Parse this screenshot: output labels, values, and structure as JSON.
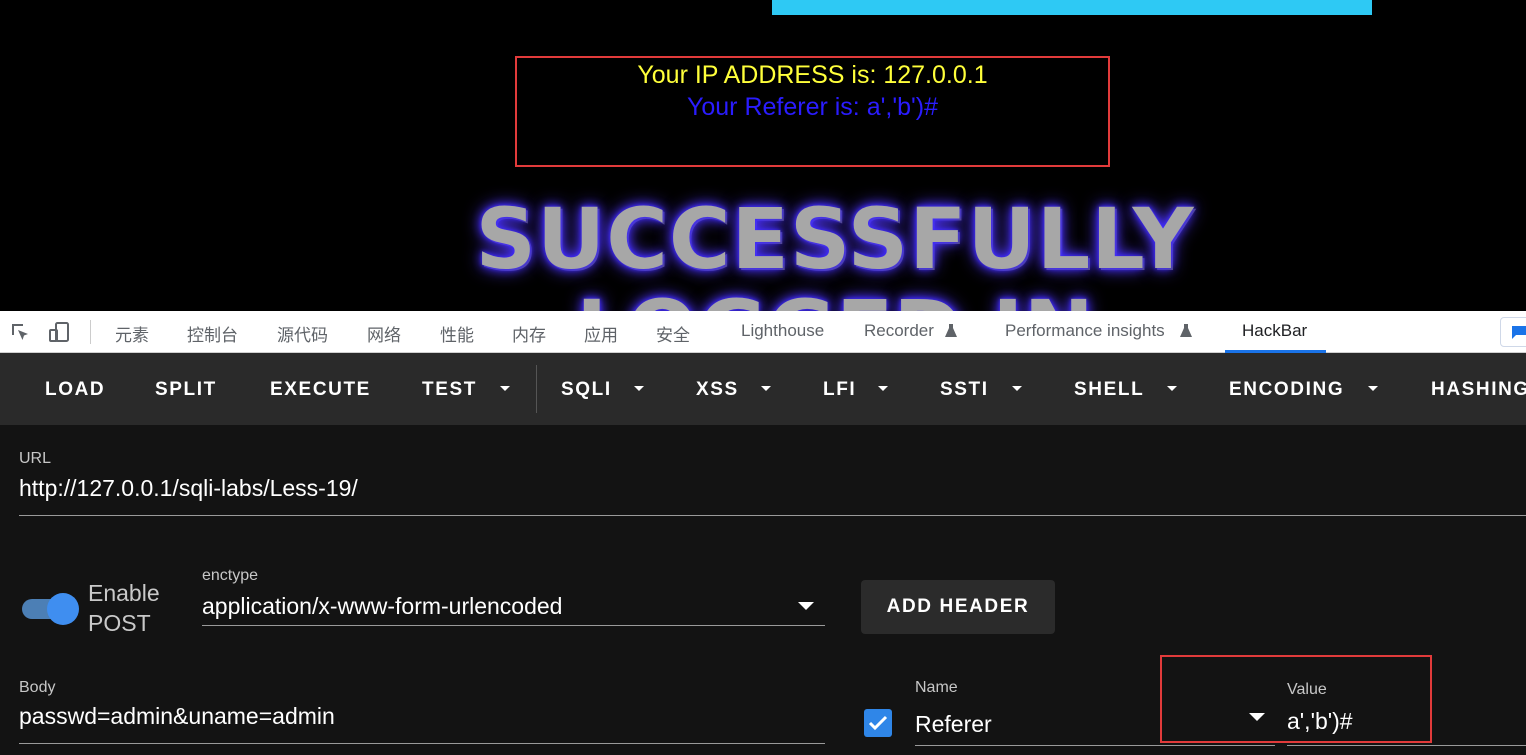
{
  "page": {
    "ip_text": "Your IP ADDRESS is: 127.0.0.1",
    "referer_text": "Your Referer is: a','b')#",
    "banner_line1": "SUCCESSFULLY",
    "banner_line2": "LOGGED IN"
  },
  "devtools": {
    "tabs": [
      "元素",
      "控制台",
      "源代码",
      "网络",
      "性能",
      "内存",
      "应用",
      "安全",
      "Lighthouse",
      "Recorder",
      "Performance insights",
      "HackBar"
    ],
    "active_tab": "HackBar"
  },
  "hackbar": {
    "toolbar": {
      "load": "LOAD",
      "split": "SPLIT",
      "execute": "EXECUTE",
      "test": "TEST",
      "sqli": "SQLI",
      "xss": "XSS",
      "lfi": "LFI",
      "ssti": "SSTI",
      "shell": "SHELL",
      "encoding": "ENCODING",
      "hashing": "HASHING"
    },
    "url_label": "URL",
    "url_value": "http://127.0.0.1/sqli-labs/Less-19/",
    "post_toggle_label_1": "Enable",
    "post_toggle_label_2": "POST",
    "enctype_label": "enctype",
    "enctype_value": "application/x-www-form-urlencoded",
    "add_header": "ADD HEADER",
    "body_label": "Body",
    "body_value": "passwd=admin&uname=admin",
    "header_name_label": "Name",
    "header_name_value": "Referer",
    "header_value_label": "Value",
    "header_value_value": "a','b')#"
  },
  "colors": {
    "ip_text": "#ffff3a",
    "referer_text": "#2a1cff",
    "highlight_box": "#e23b3b",
    "accent": "#1a73e8"
  }
}
